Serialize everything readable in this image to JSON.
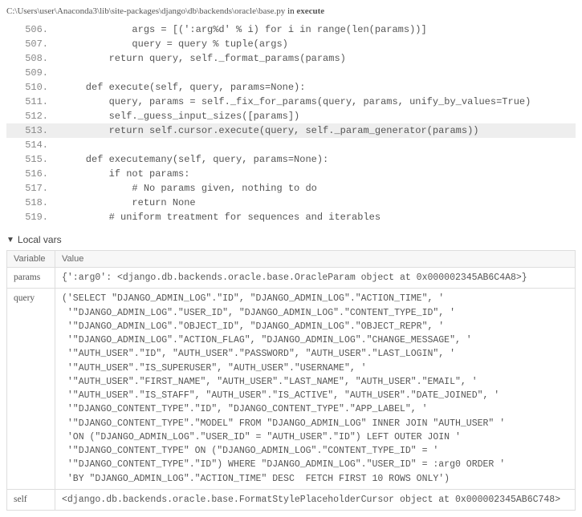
{
  "filepath_prefix": "C:\\Users\\user\\Anaconda3\\lib\\site-packages\\django\\db\\backends\\oracle\\base.py",
  "filepath_sep": " in ",
  "filepath_func": "execute",
  "code_lines": [
    {
      "n": "506.",
      "t": "            args = [(':arg%d' % i) for i in range(len(params))]",
      "hl": false
    },
    {
      "n": "507.",
      "t": "            query = query % tuple(args)",
      "hl": false
    },
    {
      "n": "508.",
      "t": "        return query, self._format_params(params)",
      "hl": false
    },
    {
      "n": "509.",
      "t": "",
      "hl": false
    },
    {
      "n": "510.",
      "t": "    def execute(self, query, params=None):",
      "hl": false
    },
    {
      "n": "511.",
      "t": "        query, params = self._fix_for_params(query, params, unify_by_values=True)",
      "hl": false
    },
    {
      "n": "512.",
      "t": "        self._guess_input_sizes([params])",
      "hl": false
    },
    {
      "n": "513.",
      "t": "        return self.cursor.execute(query, self._param_generator(params))",
      "hl": true
    },
    {
      "n": "514.",
      "t": "",
      "hl": false
    },
    {
      "n": "515.",
      "t": "    def executemany(self, query, params=None):",
      "hl": false
    },
    {
      "n": "516.",
      "t": "        if not params:",
      "hl": false
    },
    {
      "n": "517.",
      "t": "            # No params given, nothing to do",
      "hl": false
    },
    {
      "n": "518.",
      "t": "            return None",
      "hl": false
    },
    {
      "n": "519.",
      "t": "        # uniform treatment for sequences and iterables",
      "hl": false
    }
  ],
  "local_vars_label": "Local vars",
  "table_headers": {
    "var": "Variable",
    "val": "Value"
  },
  "vars": {
    "params": {
      "name": "params",
      "value": "{':arg0': <django.db.backends.oracle.base.OracleParam object at 0x000002345AB6C4A8>}"
    },
    "query": {
      "name": "query",
      "value": "('SELECT \"DJANGO_ADMIN_LOG\".\"ID\", \"DJANGO_ADMIN_LOG\".\"ACTION_TIME\", '\n '\"DJANGO_ADMIN_LOG\".\"USER_ID\", \"DJANGO_ADMIN_LOG\".\"CONTENT_TYPE_ID\", '\n '\"DJANGO_ADMIN_LOG\".\"OBJECT_ID\", \"DJANGO_ADMIN_LOG\".\"OBJECT_REPR\", '\n '\"DJANGO_ADMIN_LOG\".\"ACTION_FLAG\", \"DJANGO_ADMIN_LOG\".\"CHANGE_MESSAGE\", '\n '\"AUTH_USER\".\"ID\", \"AUTH_USER\".\"PASSWORD\", \"AUTH_USER\".\"LAST_LOGIN\", '\n '\"AUTH_USER\".\"IS_SUPERUSER\", \"AUTH_USER\".\"USERNAME\", '\n '\"AUTH_USER\".\"FIRST_NAME\", \"AUTH_USER\".\"LAST_NAME\", \"AUTH_USER\".\"EMAIL\", '\n '\"AUTH_USER\".\"IS_STAFF\", \"AUTH_USER\".\"IS_ACTIVE\", \"AUTH_USER\".\"DATE_JOINED\", '\n '\"DJANGO_CONTENT_TYPE\".\"ID\", \"DJANGO_CONTENT_TYPE\".\"APP_LABEL\", '\n '\"DJANGO_CONTENT_TYPE\".\"MODEL\" FROM \"DJANGO_ADMIN_LOG\" INNER JOIN \"AUTH_USER\" '\n 'ON (\"DJANGO_ADMIN_LOG\".\"USER_ID\" = \"AUTH_USER\".\"ID\") LEFT OUTER JOIN '\n '\"DJANGO_CONTENT_TYPE\" ON (\"DJANGO_ADMIN_LOG\".\"CONTENT_TYPE_ID\" = '\n '\"DJANGO_CONTENT_TYPE\".\"ID\") WHERE \"DJANGO_ADMIN_LOG\".\"USER_ID\" = :arg0 ORDER '\n 'BY \"DJANGO_ADMIN_LOG\".\"ACTION_TIME\" DESC  FETCH FIRST 10 ROWS ONLY')"
    },
    "self": {
      "name": "self",
      "value": "<django.db.backends.oracle.base.FormatStylePlaceholderCursor object at 0x000002345AB6C748>"
    }
  }
}
